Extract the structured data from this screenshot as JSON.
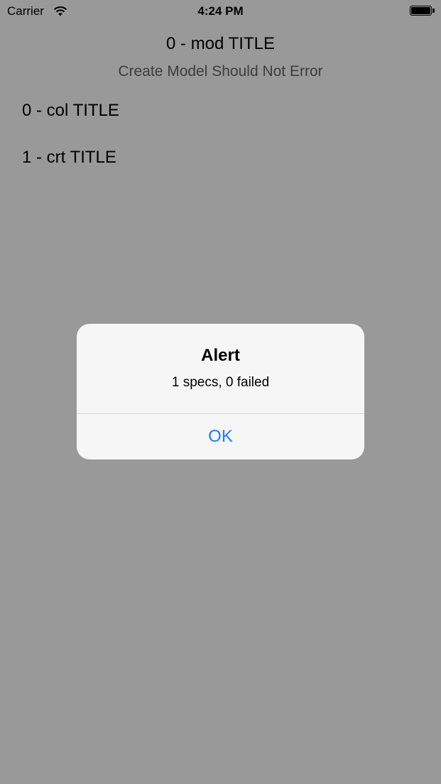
{
  "status_bar": {
    "carrier": "Carrier",
    "time": "4:24 PM",
    "wifi_icon": "wifi-icon",
    "battery_icon": "battery-icon",
    "battery_level": 1.0
  },
  "nav": {
    "title": "0 - mod TITLE",
    "subtitle": "Create Model Should Not Error"
  },
  "list": {
    "items": [
      {
        "label": "0 - col TITLE"
      },
      {
        "label": "1 - crt TITLE"
      }
    ]
  },
  "alert": {
    "title": "Alert",
    "message": "1 specs, 0 failed",
    "button_label": "OK"
  },
  "colors": {
    "accent": "#1a7cf7",
    "subtitle": "#666666",
    "overlay": "#999999"
  }
}
